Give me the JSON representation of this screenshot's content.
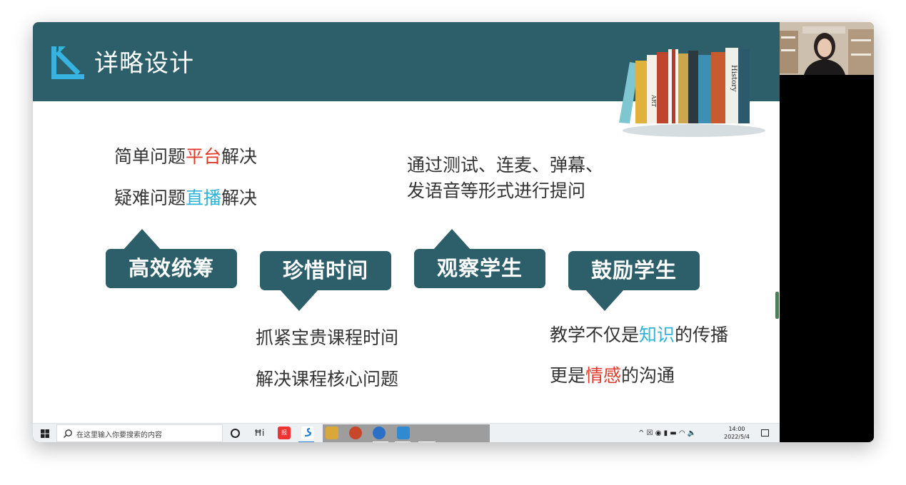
{
  "slide": {
    "title": "详略设计",
    "books": {
      "spine_art": "ART",
      "spine_history": "History"
    },
    "left_top": {
      "line1": {
        "before": "简单问题",
        "highlight": "平台",
        "after": "解决"
      },
      "line2": {
        "before": "疑难问题",
        "highlight": "直播",
        "after": "解决"
      }
    },
    "right_top": {
      "line1": "通过测试、连麦、弹幕、",
      "line2": "发语音等形式进行提问"
    },
    "boxes": [
      "高效统筹",
      "珍惜时间",
      "观察学生",
      "鼓励学生"
    ],
    "bottom_mid": {
      "line1": "抓紧宝贵课程时间",
      "line2": "解决课程核心问题"
    },
    "bottom_right": {
      "line1": {
        "before": "教学不仅是",
        "highlight": "知识",
        "after": "的传播"
      },
      "line2": {
        "before": "更是",
        "highlight": "情感",
        "after": "的沟通"
      }
    },
    "colors": {
      "header": "#2d5f6b",
      "red": "#e0392b",
      "blue": "#2fb3d8"
    }
  },
  "taskbar": {
    "search_placeholder": "在这里输入你要搜索的内容",
    "task_view": "Ħi",
    "app_badge": "报",
    "tray_icons": "^  ☒ ◉ ▮ ▬ ◠ 🔈",
    "time": "14:00",
    "date": "2022/5/4"
  }
}
